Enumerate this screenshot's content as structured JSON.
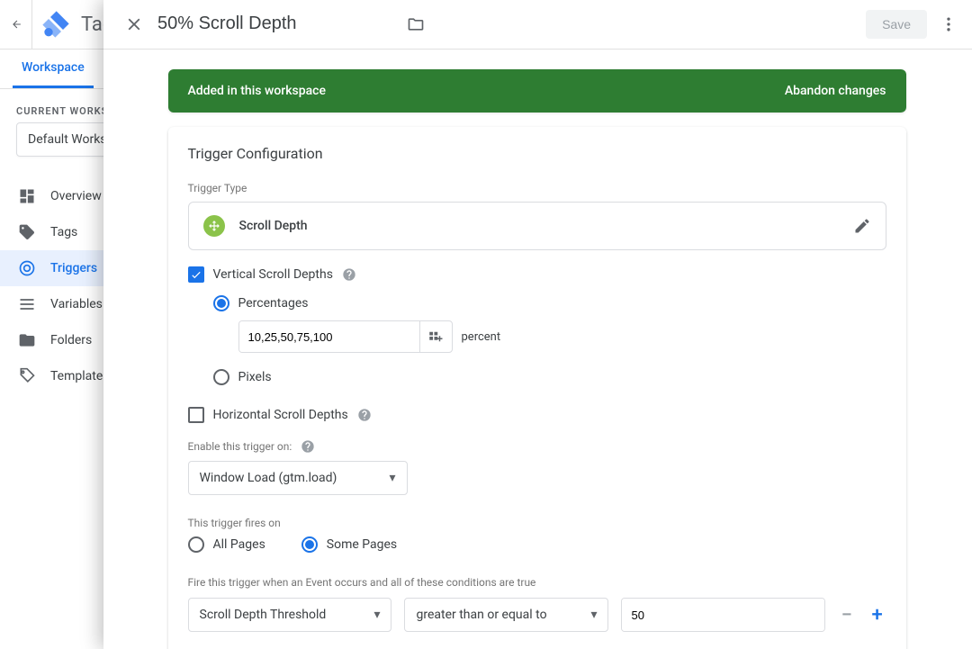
{
  "app": {
    "product_name_snippet": "Tag",
    "tab_workspace": "Workspace",
    "ws_label": "CURRENT WORKSPACE",
    "ws_name": "Default Workspace",
    "nav": {
      "overview": "Overview",
      "tags": "Tags",
      "triggers": "Triggers",
      "variables": "Variables",
      "folders": "Folders",
      "templates": "Templates"
    }
  },
  "panel": {
    "title": "50% Scroll Depth",
    "save_label": "Save",
    "banner_text": "Added in this workspace",
    "banner_action": "Abandon changes",
    "card_title": "Trigger Configuration",
    "trigger_type_label": "Trigger Type",
    "trigger_type_name": "Scroll Depth",
    "vertical_label": "Vertical Scroll Depths",
    "percentages_label": "Percentages",
    "percent_value": "10,25,50,75,100",
    "percent_unit": "percent",
    "pixels_label": "Pixels",
    "horizontal_label": "Horizontal Scroll Depths",
    "enable_label": "Enable this trigger on:",
    "enable_value": "Window Load (gtm.load)",
    "fires_label": "This trigger fires on",
    "fires_all": "All Pages",
    "fires_some": "Some Pages",
    "cond_label": "Fire this trigger when an Event occurs and all of these conditions are true",
    "cond_var": "Scroll Depth Threshold",
    "cond_op": "greater than or equal to",
    "cond_val": "50"
  }
}
